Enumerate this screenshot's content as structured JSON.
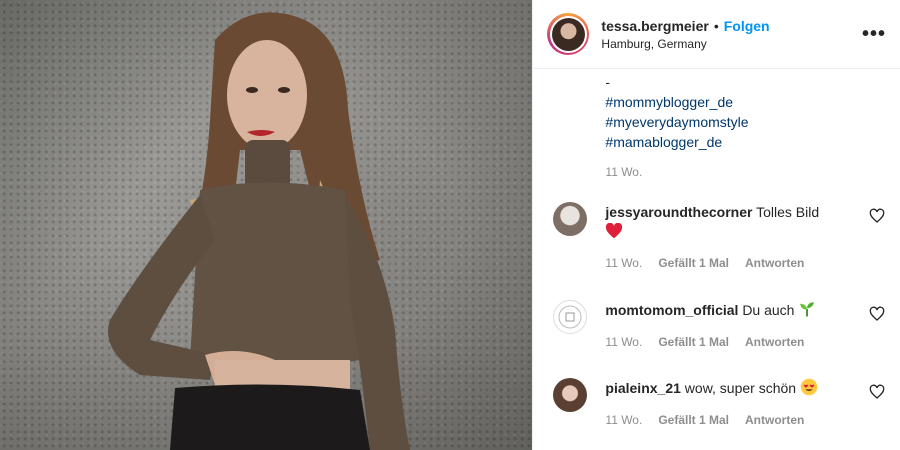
{
  "post": {
    "username": "tessa.bergmeier",
    "separator": "•",
    "follow_label": "Folgen",
    "location": "Hamburg, Germany",
    "more_label": "•••"
  },
  "caption": {
    "dash": "-",
    "hashtags": [
      "#mommyblogger_de",
      "#myeverydaymomstyle",
      "#mamablogger_de"
    ],
    "time": "11 Wo."
  },
  "comments": [
    {
      "user": "jessyaroundthecorner",
      "text": "Tolles Bild",
      "emoji": "red-heart",
      "time": "11 Wo.",
      "likes": "Gefällt 1 Mal",
      "reply": "Antworten"
    },
    {
      "user": "momtomom_official",
      "text": "Du auch",
      "emoji": "seedling",
      "time": "11 Wo.",
      "likes": "Gefällt 1 Mal",
      "reply": "Antworten"
    },
    {
      "user": "pialeinx_21",
      "text": "wow, super schön",
      "emoji": "heart-eyes",
      "time": "11 Wo.",
      "likes": "Gefällt 1 Mal",
      "reply": "Antworten"
    }
  ],
  "colors": {
    "follow": "#0095f6",
    "hashtag": "#00376b",
    "muted": "#8e8e8e",
    "heart": "#ed4956"
  }
}
